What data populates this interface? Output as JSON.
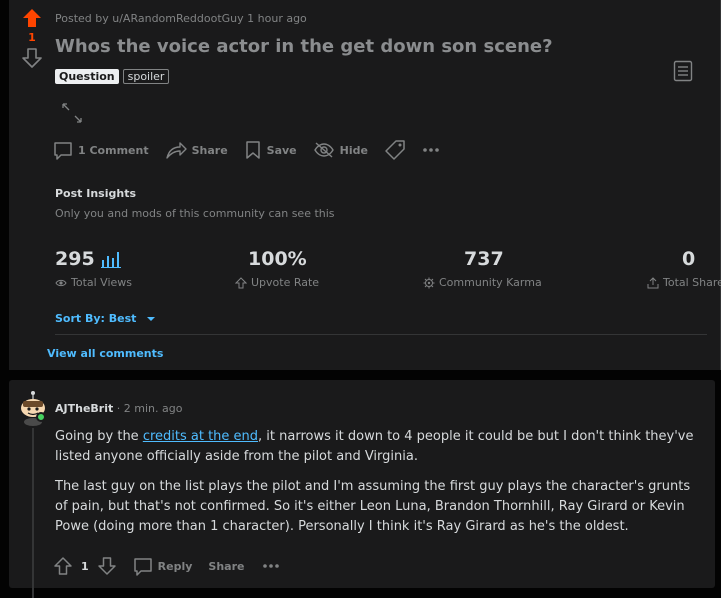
{
  "post": {
    "vote_count": "1",
    "meta": "Posted by u/ARandomReddootGuy 1 hour ago",
    "title": "Whos the voice actor in the get down son scene?",
    "flair": "Question",
    "spoiler": "spoiler",
    "actions": {
      "comments": "1 Comment",
      "share": "Share",
      "save": "Save",
      "hide": "Hide"
    }
  },
  "insights": {
    "title": "Post Insights",
    "subtitle": "Only you and mods of this community can see this",
    "stats": [
      {
        "value": "295",
        "label": "Total Views"
      },
      {
        "value": "100%",
        "label": "Upvote Rate"
      },
      {
        "value": "737",
        "label": "Community Karma"
      },
      {
        "value": "0",
        "label": "Total Shares"
      }
    ]
  },
  "sort": {
    "label": "Sort By: Best"
  },
  "view_all": "View all comments",
  "comment": {
    "author": "AJTheBrit",
    "separator": "·",
    "time": "2 min. ago",
    "p1_before": "Going by the ",
    "p1_link": "credits at the end",
    "p1_after": ", it narrows it down to 4 people it could be but I don't think they've listed anyone officially aside from the pilot and Virginia.",
    "p2": "The last guy on the list plays the pilot and I'm assuming the first guy plays the character's grunts of pain, but that's not confirmed. So it's either Leon Luna, Brandon Thornhill, Ray Girard or Kevin Powe (doing more than 1 character). Personally I think it's Ray Girard as he's the oldest.",
    "votes": "1",
    "reply": "Reply",
    "share": "Share"
  },
  "colors": {
    "upvote": "#ff4500",
    "link": "#4fbcff",
    "online": "#46d160"
  }
}
